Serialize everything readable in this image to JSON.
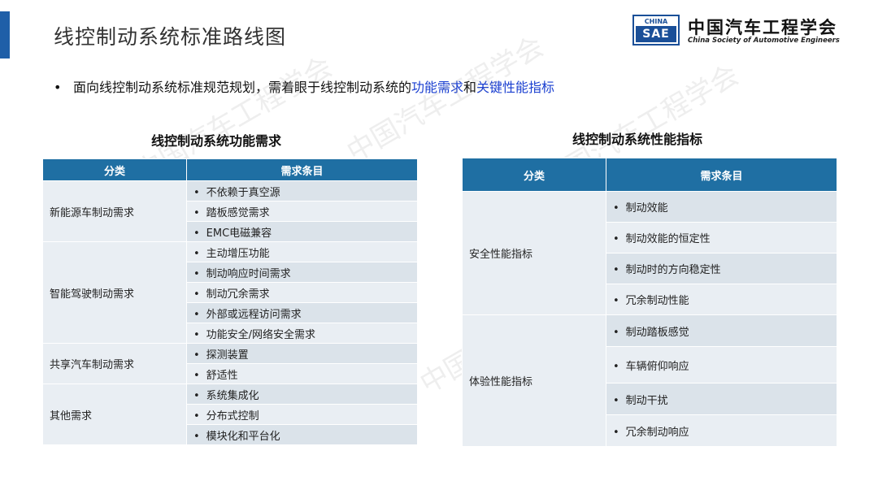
{
  "slide": {
    "title": "线控制动系统标准路线图",
    "bullet_prefix": "面向线控制动系统标准规范规划，需着眼于线控制动系统的",
    "bullet_hl1": "功能需求",
    "bullet_mid": "和",
    "bullet_hl2": "关键性能指标"
  },
  "logo": {
    "box_top": "CHINA",
    "box_bottom": "SAE",
    "name_cn": "中国汽车工程学会",
    "name_en": "China Society of Automotive Engineers"
  },
  "watermark_text": "中国汽车工程学会",
  "colors": {
    "accent": "#1f5fa8",
    "header": "#1f6fa3",
    "highlight": "#1a3fd0",
    "row_a": "#e9eef3",
    "row_b": "#dbe3ea"
  },
  "table1": {
    "title": "线控制动系统功能需求",
    "headers": [
      "分类",
      "需求条目"
    ],
    "groups": [
      {
        "category": "新能源车制动需求",
        "items": [
          "不依赖于真空源",
          "踏板感觉需求",
          "EMC电磁兼容"
        ]
      },
      {
        "category": "智能驾驶制动需求",
        "items": [
          "主动增压功能",
          "制动响应时间需求",
          "制动冗余需求",
          "外部或远程访问需求",
          "功能安全/网络安全需求"
        ]
      },
      {
        "category": "共享汽车制动需求",
        "items": [
          "探测装置",
          "舒适性"
        ]
      },
      {
        "category": "其他需求",
        "items": [
          "系统集成化",
          "分布式控制",
          "模块化和平台化"
        ]
      }
    ]
  },
  "table2": {
    "title": "线控制动系统性能指标",
    "headers": [
      "分类",
      "需求条目"
    ],
    "groups": [
      {
        "category": "安全性能指标",
        "items": [
          "制动效能",
          "制动效能的恒定性",
          "制动时的方向稳定性",
          "冗余制动性能"
        ]
      },
      {
        "category": "体验性能指标",
        "items": [
          "制动踏板感觉",
          "车辆俯仰响应",
          "制动干扰",
          "冗余制动响应"
        ]
      }
    ]
  }
}
